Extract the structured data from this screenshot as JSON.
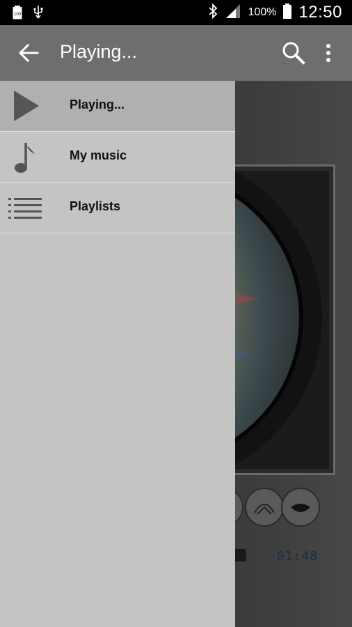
{
  "status_bar": {
    "battery_label": "100",
    "battery_percent": "100%",
    "time": "12:50",
    "icons": [
      "battery-icon",
      "usb-icon",
      "bluetooth-icon",
      "signal-icon",
      "battery-full-icon"
    ]
  },
  "app_bar": {
    "title": "Playing...",
    "back_icon": "arrow-left-icon",
    "search_icon": "search-icon",
    "overflow_icon": "more-vert-icon"
  },
  "drawer": {
    "items": [
      {
        "label": "Playing...",
        "icon": "play-icon",
        "active": true
      },
      {
        "label": "My music",
        "icon": "music-note-icon",
        "active": false
      },
      {
        "label": "Playlists",
        "icon": "list-icon",
        "active": false
      }
    ]
  },
  "player": {
    "time_remaining": "-01:48"
  },
  "colors": {
    "app_bar": "#6e6e6e",
    "drawer": "#c4c4c4",
    "drawer_active": "#b0b0b0",
    "status_bar": "#000000"
  }
}
